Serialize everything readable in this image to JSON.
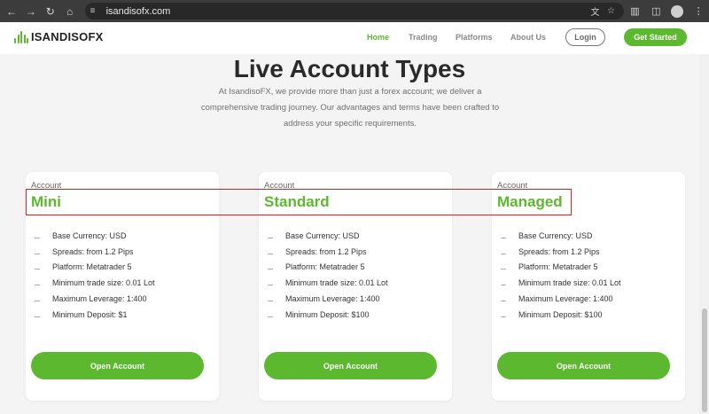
{
  "browser": {
    "url": "isandisofx.com",
    "back_icon": "arrow-left-icon",
    "forward_icon": "arrow-right-icon",
    "reload_icon": "reload-icon",
    "home_icon": "home-icon"
  },
  "site": {
    "logo_text": "ISANDISOFX",
    "nav": [
      "Home",
      "Trading",
      "Platforms",
      "About Us"
    ],
    "login_label": "Login",
    "get_started_label": "Get Started",
    "accent_color": "#5cb82e"
  },
  "page": {
    "title": "Live Account Types",
    "intro_lines": [
      "At IsandisoFX, we provide more than just a forex account; we deliver a",
      "comprehensive trading journey. Our advantages and terms have been crafted to",
      "address your specific requirements."
    ]
  },
  "accounts": [
    {
      "label": "Account",
      "name": "Mini",
      "features": [
        "Base Currency: USD",
        "Spreads: from 1.2 Pips",
        "Platform: Metatrader 5",
        "Minimum trade size: 0.01 Lot",
        "Maximum Leverage: 1:400",
        "Minimum Deposit: $1"
      ],
      "button": "Open Account"
    },
    {
      "label": "Account",
      "name": "Standard",
      "features": [
        "Base Currency: USD",
        "Spreads: from 1.2 Pips",
        "Platform: Metatrader 5",
        "Minimum trade size: 0.01 Lot",
        "Maximum Leverage: 1:400",
        "Minimum Deposit: $100"
      ],
      "button": "Open Account"
    },
    {
      "label": "Account",
      "name": "Managed",
      "features": [
        "Base Currency: USD",
        "Spreads: from 1.2 Pips",
        "Platform: Metatrader 5",
        "Minimum trade size: 0.01 Lot",
        "Maximum Leverage: 1:400",
        "Minimum Deposit: $100"
      ],
      "button": "Open Account"
    }
  ]
}
